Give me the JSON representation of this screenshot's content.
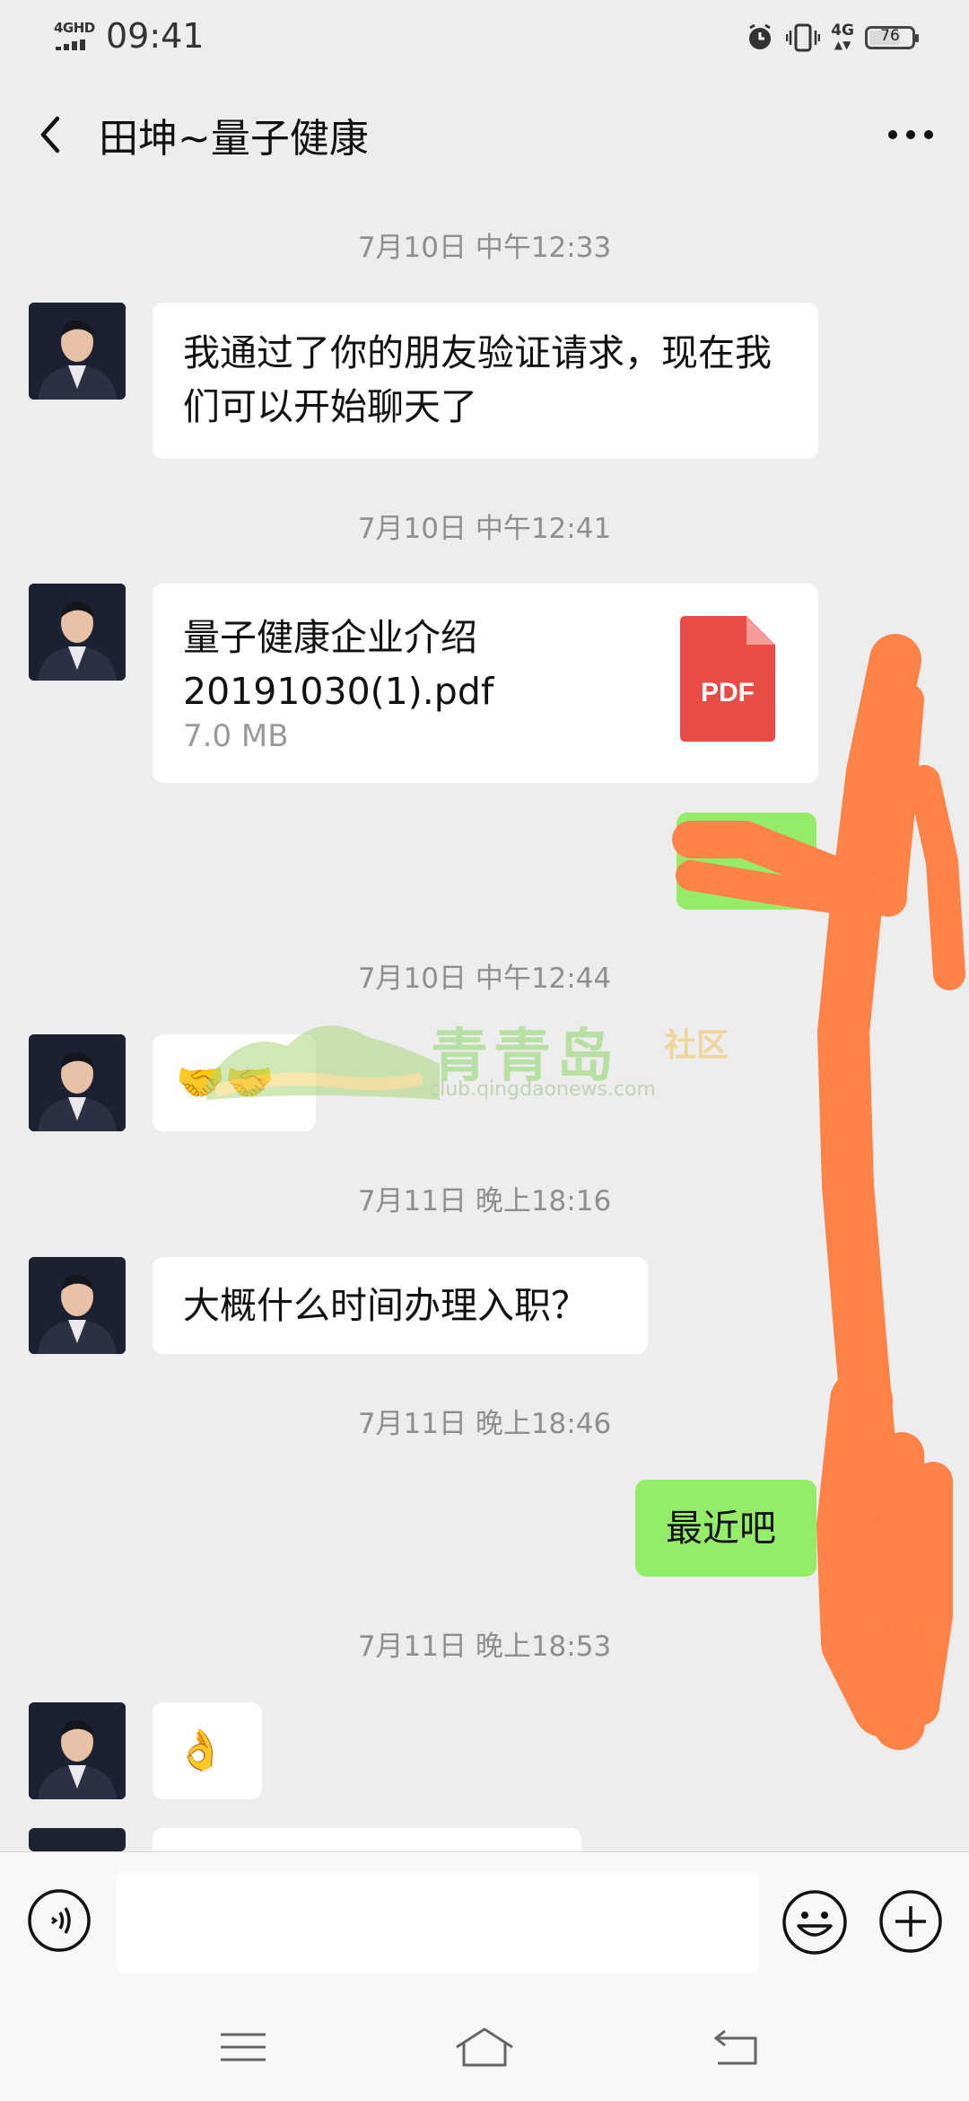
{
  "status_bar": {
    "network": "4GHD",
    "time": "09:41",
    "network_right": "4G",
    "battery": 76,
    "icons": [
      "alarm-icon",
      "vibrate-icon"
    ]
  },
  "header": {
    "title": "田坤~量子健康",
    "back_icon": "chevron-left-icon",
    "more_icon": "more-dots-icon"
  },
  "messages": [
    {
      "type": "time",
      "text": "7月10日 中午12:33"
    },
    {
      "type": "text",
      "from": "them",
      "text": "我通过了你的朋友验证请求，现在我们可以开始聊天了"
    },
    {
      "type": "time",
      "text": "7月10日 中午12:41"
    },
    {
      "type": "file",
      "from": "them",
      "filename": "量子健康企业介绍20191030(1).pdf",
      "size": "7.0 MB",
      "file_icon": "PDF"
    },
    {
      "type": "text",
      "from": "me",
      "text": "",
      "note": "obscured"
    },
    {
      "type": "time",
      "text": "7月10日 中午12:44"
    },
    {
      "type": "emoji",
      "from": "them",
      "text": "🤝🤝"
    },
    {
      "type": "time",
      "text": "7月11日 晚上18:16"
    },
    {
      "type": "text",
      "from": "them",
      "text": "大概什么时间办理入职？"
    },
    {
      "type": "time",
      "text": "7月11日 晚上18:46"
    },
    {
      "type": "text",
      "from": "me",
      "text": "最近吧"
    },
    {
      "type": "time",
      "text": "7月11日 晚上18:53"
    },
    {
      "type": "emoji",
      "from": "them",
      "text": "👌"
    }
  ],
  "watermark": {
    "title": "青青岛",
    "subtitle": "社区",
    "url": "club.qingdaonews.com"
  },
  "input_bar": {
    "placeholder": "",
    "icons": [
      "voice-icon",
      "emoji-icon",
      "plus-icon"
    ]
  },
  "nav_bar": {
    "icons": [
      "menu-icon",
      "home-icon",
      "back-nav-icon"
    ]
  },
  "colors": {
    "background": "#ededed",
    "incoming_bubble": "#ffffff",
    "outgoing_bubble": "#95ec69",
    "scribble": "#ff8247",
    "pdf_red": "#e94b47"
  }
}
